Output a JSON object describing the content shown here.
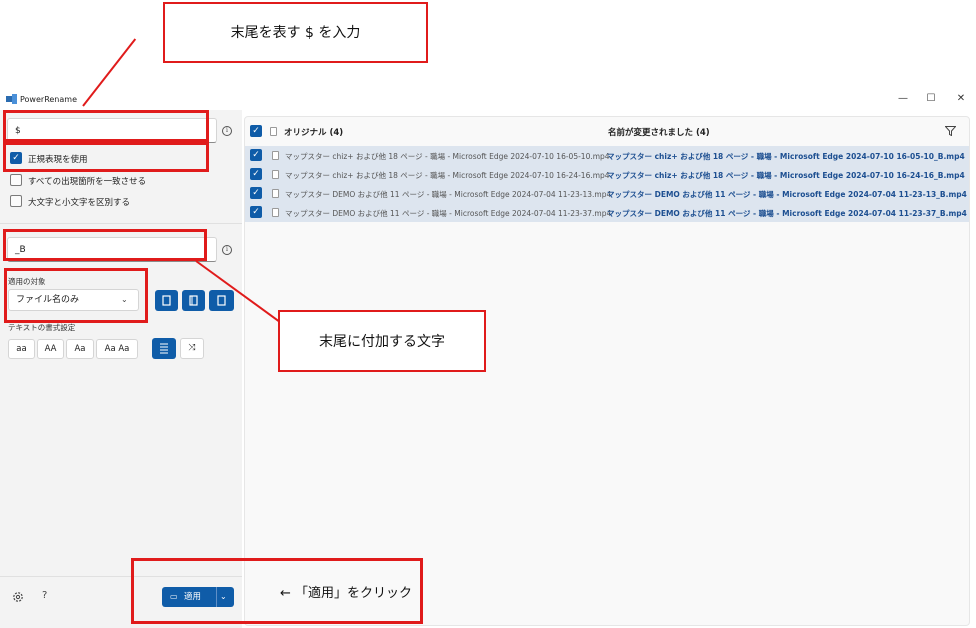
{
  "window": {
    "title": "PowerRename",
    "minimize": "—",
    "maximize": "☐",
    "close": "✕"
  },
  "search": {
    "value": "$",
    "info_icon": "i"
  },
  "options": {
    "regex": "正規表現を使用",
    "match_all": "すべての出現箇所を一致させる",
    "case_sensitive": "大文字と小文字を区別する"
  },
  "replace": {
    "value": "_B",
    "info_icon": "i"
  },
  "apply_to": {
    "label": "適用の対象",
    "selected": "ファイル名のみ"
  },
  "text_format": {
    "label": "テキストの書式設定",
    "buttons": [
      "aa",
      "AA",
      "Aa",
      "Aa Aa"
    ]
  },
  "footer": {
    "help": "?",
    "apply_label": "適用"
  },
  "list": {
    "original_header": "オリジナル (4)",
    "renamed_header": "名前が変更されました (4)",
    "rows": [
      {
        "original": "マップスター chiz+ および他 18 ページ - 職場 - Microsoft Edge 2024-07-10 16-05-10.mp4",
        "renamed": "マップスター chiz+ および他 18 ページ - 職場 - Microsoft Edge 2024-07-10 16-05-10_B.mp4"
      },
      {
        "original": "マップスター chiz+ および他 18 ページ - 職場 - Microsoft Edge 2024-07-10 16-24-16.mp4",
        "renamed": "マップスター chiz+ および他 18 ページ - 職場 - Microsoft Edge 2024-07-10 16-24-16_B.mp4"
      },
      {
        "original": "マップスター DEMO および他 11 ページ - 職場 - Microsoft Edge 2024-07-04 11-23-13.mp4",
        "renamed": "マップスター DEMO および他 11 ページ - 職場 - Microsoft Edge 2024-07-04 11-23-13_B.mp4"
      },
      {
        "original": "マップスター DEMO および他 11 ページ - 職場 - Microsoft Edge 2024-07-04 11-23-37.mp4",
        "renamed": "マップスター DEMO および他 11 ページ - 職場 - Microsoft Edge 2024-07-04 11-23-37_B.mp4"
      }
    ]
  },
  "annotations": {
    "top": "末尾を表す $ を入力",
    "middle": "末尾に付加する文字",
    "bottom": "← 「適用」をクリック"
  },
  "colors": {
    "accent": "#0f5ca8",
    "annotation": "#e01b1b",
    "row_highlight": "#dde5ef"
  }
}
